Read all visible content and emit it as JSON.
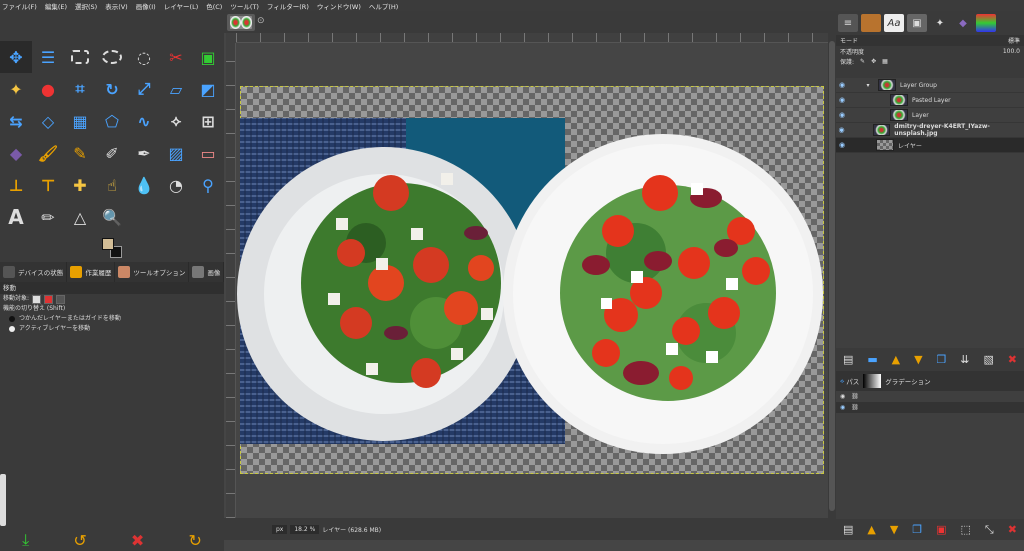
{
  "menu": [
    "ファイル(F)",
    "編集(E)",
    "選択(S)",
    "表示(V)",
    "画像(I)",
    "レイヤー(L)",
    "色(C)",
    "ツール(T)",
    "フィルター(R)",
    "ウィンドウ(W)",
    "ヘルプ(H)"
  ],
  "dock_tabs": {
    "device": "デバイスの状態",
    "undo": "作業履歴",
    "tool_options": "ツールオプション",
    "images": "画像"
  },
  "tool_options": {
    "title": "移動",
    "target_label": "移動対象:",
    "toggle_label": "機能の切り替え (Shift)",
    "option_pick": "つかんだレイヤーまたはガイドを移動",
    "option_active": "アクティブレイヤーを移動"
  },
  "statusbar": {
    "unit": "px",
    "zoom": "18.2 %",
    "info": "レイヤー (628.6 MB)"
  },
  "layers_panel": {
    "mode_label": "モード",
    "mode_value": "標準",
    "opacity_label": "不透明度",
    "opacity_value": "100.0",
    "lock_label": "保護:",
    "layers": [
      {
        "name": "Layer Group",
        "indent": 1
      },
      {
        "name": "Pasted Layer",
        "indent": 2
      },
      {
        "name": "Layer",
        "indent": 2
      },
      {
        "name": "dmitry-dreyer-K4ERT_IYazw-unsplash.jpg",
        "indent": 0
      },
      {
        "name": "レイヤー",
        "indent": 0
      }
    ]
  },
  "paths_panel": {
    "tab_paths": "パス",
    "tab_gradient": "グラデーション"
  }
}
